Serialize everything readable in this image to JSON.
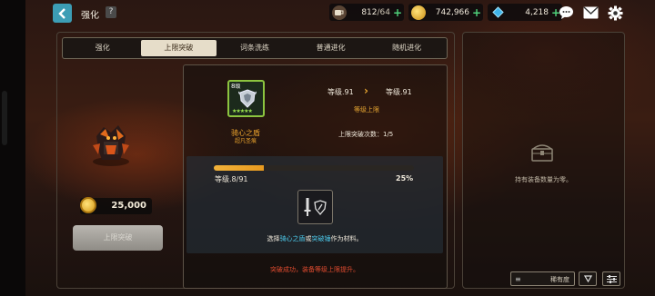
{
  "header": {
    "back_icon": "back-arrow-icon",
    "title": "强化",
    "help_label": "?"
  },
  "resources": {
    "stamina": {
      "icon": "stamina-cup-icon",
      "value": "812",
      "max": "/64"
    },
    "gold": {
      "icon": "gold-coin-icon",
      "value": "742,966"
    },
    "gems": {
      "icon": "diamond-icon",
      "value": "4,218"
    }
  },
  "top_buttons": [
    "chat-icon",
    "mail-icon",
    "settings-gear-icon"
  ],
  "tabs": [
    {
      "label": "强化",
      "active": false
    },
    {
      "label": "上限突破",
      "active": true
    },
    {
      "label": "词条洗练",
      "active": false
    },
    {
      "label": "普通进化",
      "active": false
    },
    {
      "label": "随机进化",
      "active": false
    }
  ],
  "left": {
    "cost": "25,000",
    "break_button": "上限突破"
  },
  "item": {
    "card_level": "8",
    "card_level_suffix": "级",
    "stars": "★★★★★",
    "name": "骑心之盾",
    "grade": "超凡圣痕",
    "level_from": "等级.91",
    "level_to": "等级.91",
    "cap_label": "等级上限",
    "break_count": "上限突破次数：1/5"
  },
  "progress": {
    "level_text": "等级.8/91",
    "percent_text": "25%",
    "fraction": 0.25
  },
  "material": {
    "prefix": "选择",
    "hl1": "骑心之盾",
    "mid": "或",
    "hl2": "突破锤",
    "suffix": "作为材料。"
  },
  "status": "突破成功，装备等级上限提升。",
  "inventory": {
    "empty_text": "持有装备数量为零。",
    "sort_label": "稀有度",
    "sort_icon": "list-icon",
    "order_icon": "triangle-down-icon",
    "filter_icon": "filter-sliders-icon"
  },
  "colors": {
    "accent_gold": "#e6a531",
    "highlight_blue": "#4cc7e8",
    "status_red": "#e04b2f",
    "plus_green": "#4fd27b"
  }
}
